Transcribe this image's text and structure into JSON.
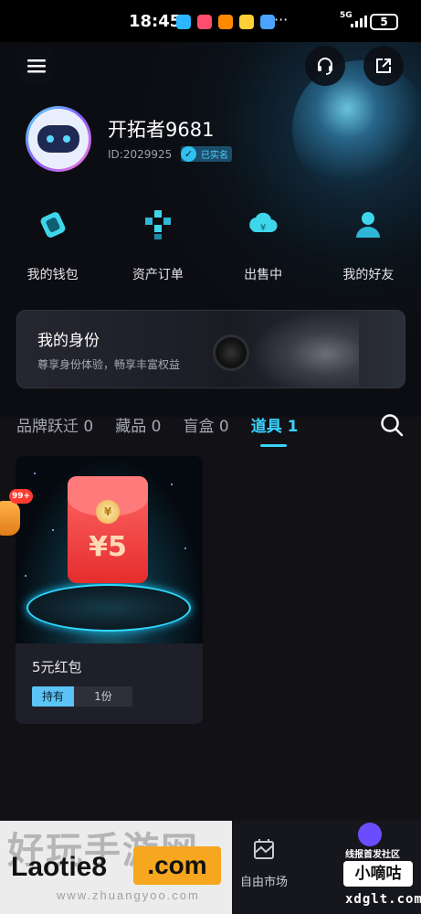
{
  "status_bar": {
    "time": "18:45",
    "network": "5G",
    "battery": "5",
    "more": "···"
  },
  "profile": {
    "username": "开拓者9681",
    "id": "ID:2029925",
    "verified_label": "已实名"
  },
  "quick_actions": [
    {
      "label": "我的钱包",
      "icon": "wallet-icon"
    },
    {
      "label": "资产订单",
      "icon": "asset-order-icon"
    },
    {
      "label": "出售中",
      "icon": "on-sale-icon"
    },
    {
      "label": "我的好友",
      "icon": "friends-icon"
    }
  ],
  "identity_banner": {
    "title": "我的身份",
    "subtitle": "尊享身份体验，畅享丰富权益"
  },
  "tabs": [
    {
      "label": "品牌跃迁 0",
      "active": false
    },
    {
      "label": "藏品 0",
      "active": false
    },
    {
      "label": "盲盒 0",
      "active": false
    },
    {
      "label": "道具 1",
      "active": true
    }
  ],
  "item_card": {
    "amount": "¥5",
    "coin": "¥",
    "name": "5元红包",
    "hold_label": "持有",
    "hold_count": "1份"
  },
  "float_badge": "99+",
  "bottom_nav": {
    "market_label": "自由市场"
  },
  "watermark": {
    "brand": "Laotie8",
    "domain": ".com",
    "ghost_text": "好玩手游网",
    "sub": "www.zhuangyoo.com"
  },
  "watermark2": {
    "line1": "线报首发社区",
    "line2": "小嘀咕",
    "line3": "xdglt.com"
  },
  "colors": {
    "accent": "#3ad3ff",
    "red_packet": "#e52d2d",
    "badge": "#ff3b30"
  }
}
